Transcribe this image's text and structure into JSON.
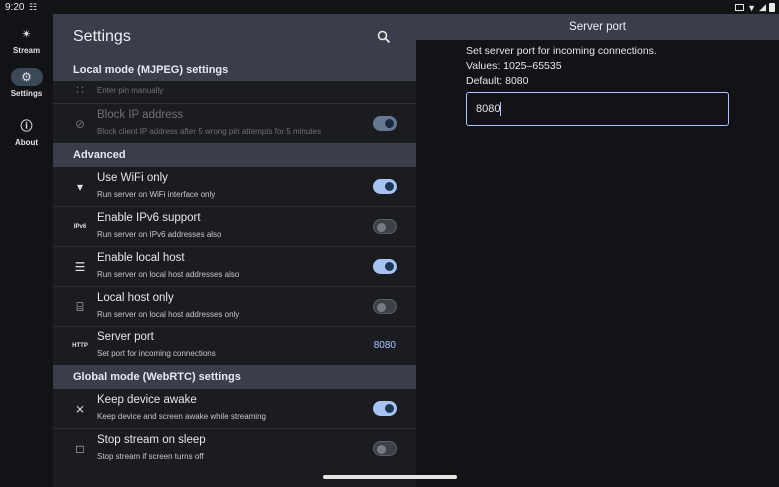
{
  "status_bar": {
    "time": "9:20",
    "left_icon": "network-icon",
    "right_icons": [
      "notification-icon",
      "wifi-icon",
      "signal-icon",
      "battery-icon"
    ]
  },
  "nav": {
    "items": [
      {
        "label": "Stream",
        "icon": "stream-icon",
        "active": false
      },
      {
        "label": "Settings",
        "icon": "gear-icon",
        "active": true
      },
      {
        "label": "About",
        "icon": "info-icon",
        "active": false
      }
    ]
  },
  "settings": {
    "title": "Settings",
    "search_icon": "search-icon",
    "sections": {
      "local": "Local mode (MJPEG) settings",
      "advanced": "Advanced",
      "global": "Global mode (WebRTC) settings"
    },
    "rows": {
      "pin": {
        "subtitle": "Enter pin manually",
        "icon": "dialpad-icon"
      },
      "block_ip": {
        "title": "Block IP address",
        "subtitle": "Block client IP address after 5 wrong pin attempts for 5 minutes",
        "on": true,
        "enabled": false,
        "icon": "block-icon"
      },
      "wifi_only": {
        "title": "Use WiFi only",
        "subtitle": "Run server on WiFi interface only",
        "on": true,
        "icon": "wifi-icon"
      },
      "ipv6": {
        "title": "Enable IPv6 support",
        "subtitle": "Run server on IPv6 addresses also",
        "on": false,
        "icon_text": "IPv6"
      },
      "local_host": {
        "title": "Enable local host",
        "subtitle": "Run server on local host addresses also",
        "on": true,
        "icon": "local-host-icon"
      },
      "local_only": {
        "title": "Local host only",
        "subtitle": "Run server on local host addresses only",
        "on": false,
        "icon": "local-host-only-icon"
      },
      "server_port": {
        "title": "Server port",
        "subtitle": "Set port for incoming connections",
        "value": "8080",
        "icon_text": "HTTP"
      },
      "keep_awake": {
        "title": "Keep device awake",
        "subtitle": "Keep device and screen awake while streaming",
        "on": true,
        "icon": "awake-icon"
      },
      "stop_sleep": {
        "title": "Stop stream on sleep",
        "subtitle": "Stop stream if screen turns off",
        "on": false,
        "icon": "stop-icon"
      }
    }
  },
  "dialog": {
    "title": "Server port",
    "line1": "Set server port for incoming connections.",
    "line2": "Values: 1025–65535",
    "line3": "Default: 8080",
    "input_value": "8080"
  },
  "colors": {
    "accent": "#a5c4f2",
    "header_bg": "#3a3d4a",
    "panel_bg": "#1b1c1f",
    "background": "#121316"
  }
}
